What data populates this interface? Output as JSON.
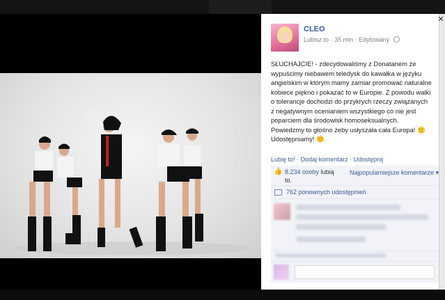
{
  "post": {
    "page_name": "CLEO",
    "like_page": "Lubisz to",
    "time": "35 min",
    "edited": "Edytowany",
    "text": "SŁUCHAJCIE! - zdecydowaliśmy z Donatanem że wypuścimy niebawem teledysk do kawałka w języku angielskim w którym mamy zamiar promować naturalne kobiece piękno i pokazać to w Europie. Z powodu walki o tolerancje dochodzi do przykrych rzeczy związanych z negatywnym ocenianiem wszystkiego co nie jest poparciem dla środowisk homoseksualnych. Powiedzmy to głośno żeby usłyszała cała Europa! 🙂 Udostępniamy! 🙂"
  },
  "actions": {
    "like": "Lubię to!",
    "comment": "Dodaj komentarz",
    "share": "Udostępnij",
    "separator": "·"
  },
  "ufi": {
    "likes_count": "8.234 osoby",
    "likes_suffix": "lubią to.",
    "sort_label": "Najpopularniejsze komentarze ▾",
    "shares": "762 ponownych udostępnień"
  },
  "icons": {
    "like": "thumbs-up-icon",
    "share": "share-icon",
    "privacy": "globe-icon",
    "close": "close-icon"
  },
  "colors": {
    "link": "#3b5998",
    "ufi_bg": "#f1f3f8",
    "stage_bg": "#000000"
  }
}
